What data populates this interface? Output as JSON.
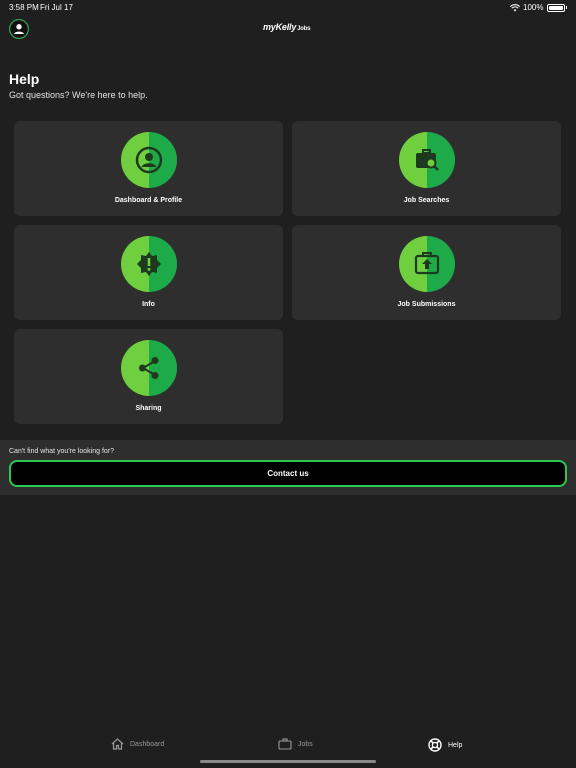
{
  "status_bar": {
    "time": "3:58 PM",
    "date": "Fri Jul 17",
    "battery": "100%"
  },
  "header": {
    "logo_main": "myKelly",
    "logo_sub": "Jobs"
  },
  "page": {
    "title": "Help",
    "subtitle": "Got questions? We're here to help."
  },
  "cards": [
    {
      "label": "Dashboard & Profile",
      "icon": "account-circle-icon"
    },
    {
      "label": "Job Searches",
      "icon": "briefcase-search-icon"
    },
    {
      "label": "Info",
      "icon": "alert-badge-icon"
    },
    {
      "label": "Job Submissions",
      "icon": "briefcase-upload-icon"
    },
    {
      "label": "Sharing",
      "icon": "share-icon"
    }
  ],
  "contact": {
    "prompt": "Can't find what you're looking for?",
    "button_label": "Contact us"
  },
  "tabs": [
    {
      "label": "Dashboard",
      "icon": "home-icon",
      "active": false
    },
    {
      "label": "Jobs",
      "icon": "briefcase-icon",
      "active": false
    },
    {
      "label": "Help",
      "icon": "lifebuoy-icon",
      "active": true
    }
  ],
  "colors": {
    "background": "#1f1f1f",
    "card": "#2e2e2e",
    "accent_light": "#6fcf3f",
    "accent_dark": "#1faa4a",
    "contact_border": "#2ec74f"
  }
}
